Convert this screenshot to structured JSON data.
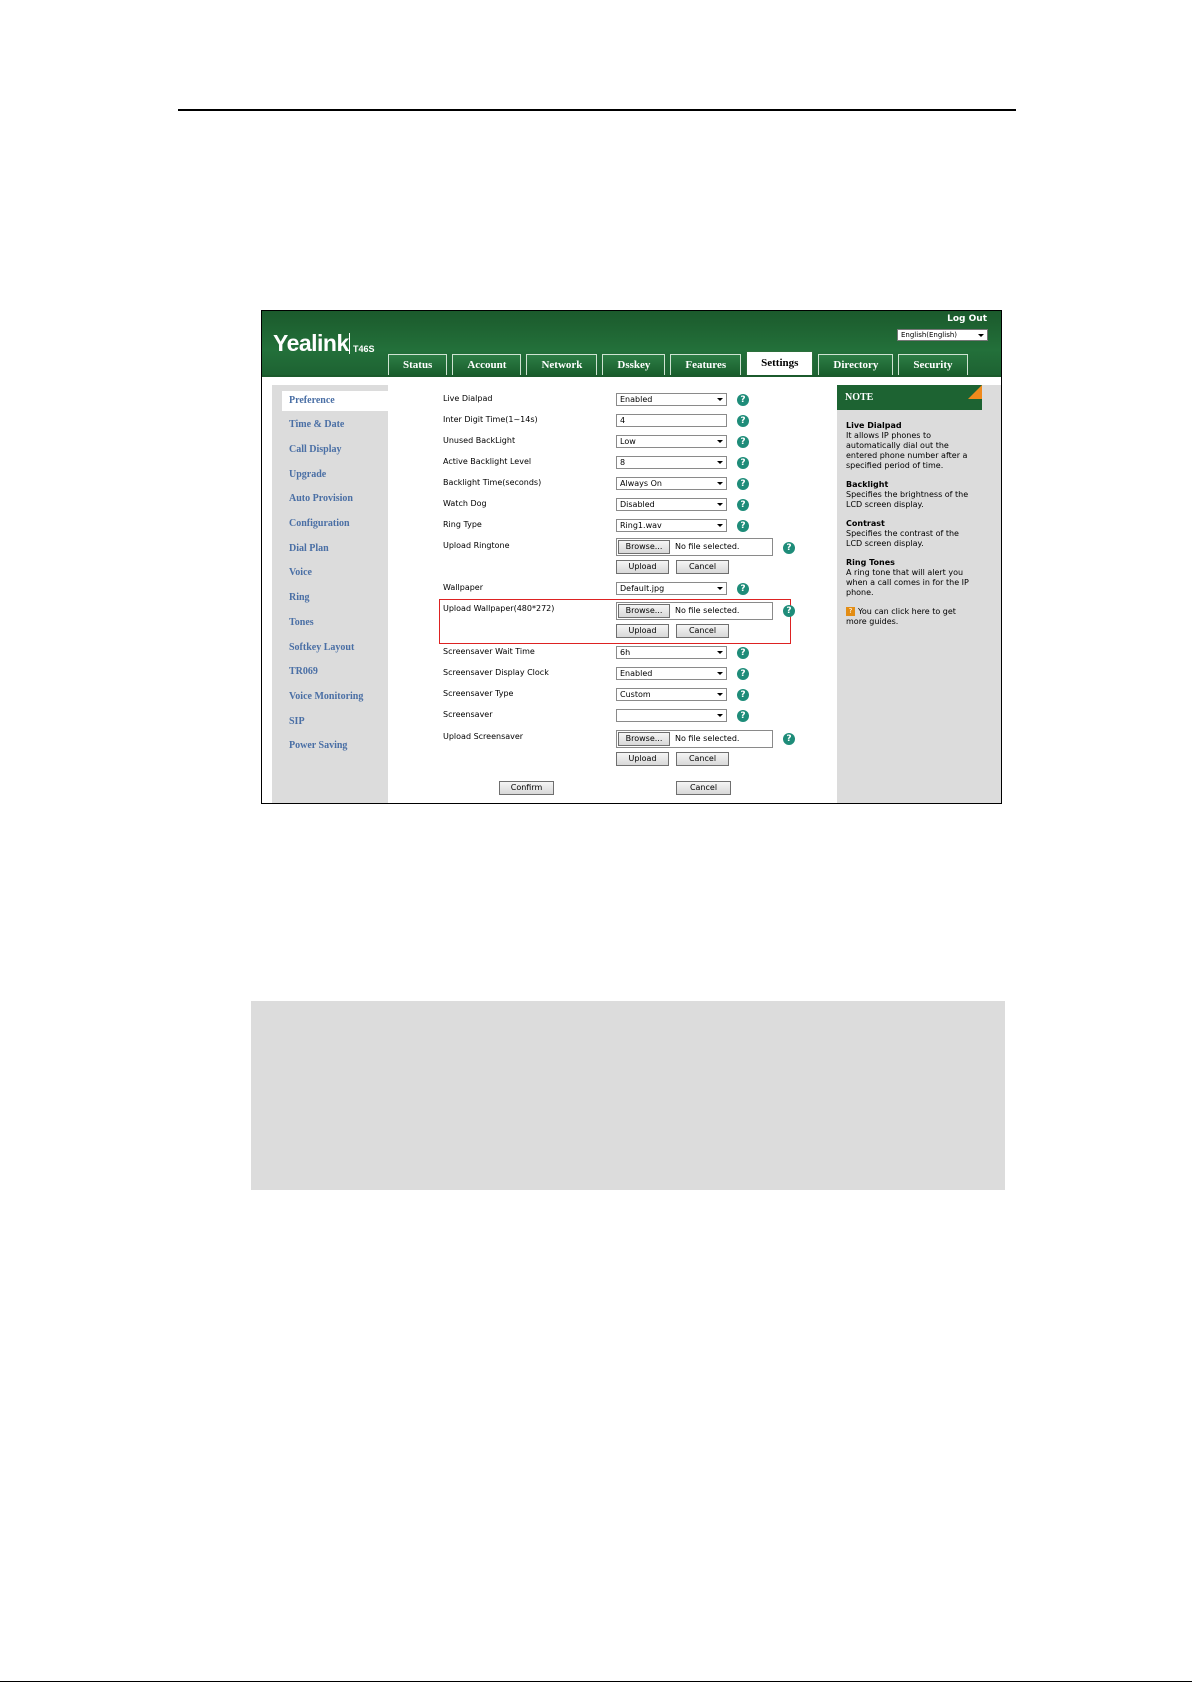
{
  "window": {
    "logo": "Yealink",
    "model": "T46S",
    "logout": "Log Out",
    "language": "English(English)"
  },
  "tabs": [
    "Status",
    "Account",
    "Network",
    "Dsskey",
    "Features",
    "Settings",
    "Directory",
    "Security"
  ],
  "active_tab": "Settings",
  "sidebar": {
    "items": [
      "Preference",
      "Time & Date",
      "Call Display",
      "Upgrade",
      "Auto Provision",
      "Configuration",
      "Dial Plan",
      "Voice",
      "Ring",
      "Tones",
      "Softkey Layout",
      "TR069",
      "Voice Monitoring",
      "SIP",
      "Power Saving"
    ],
    "active": "Preference"
  },
  "form": {
    "live_dialpad": {
      "label": "Live Dialpad",
      "value": "Enabled"
    },
    "inter_digit_time": {
      "label": "Inter Digit Time(1~14s)",
      "value": "4"
    },
    "unused_backlight": {
      "label": "Unused BackLight",
      "value": "Low"
    },
    "active_backlight": {
      "label": "Active Backlight Level",
      "value": "8"
    },
    "backlight_time": {
      "label": "Backlight Time(seconds)",
      "value": "Always On"
    },
    "watch_dog": {
      "label": "Watch Dog",
      "value": "Disabled"
    },
    "ring_type": {
      "label": "Ring Type",
      "value": "Ring1.wav"
    },
    "upload_ringtone": {
      "label": "Upload Ringtone",
      "browse": "Browse...",
      "file": "No file selected.",
      "upload": "Upload",
      "cancel": "Cancel"
    },
    "wallpaper": {
      "label": "Wallpaper",
      "value": "Default.jpg"
    },
    "upload_wallpaper": {
      "label": "Upload Wallpaper(480*272)",
      "browse": "Browse...",
      "file": "No file selected.",
      "upload": "Upload",
      "cancel": "Cancel"
    },
    "screensaver_wait": {
      "label": "Screensaver Wait Time",
      "value": "6h"
    },
    "screensaver_clock": {
      "label": "Screensaver Display Clock",
      "value": "Enabled"
    },
    "screensaver_type": {
      "label": "Screensaver Type",
      "value": "Custom"
    },
    "screensaver": {
      "label": "Screensaver",
      "value": ""
    },
    "upload_screensaver": {
      "label": "Upload Screensaver",
      "browse": "Browse...",
      "file": "No file selected.",
      "upload": "Upload",
      "cancel": "Cancel"
    },
    "confirm": "Confirm",
    "cancel": "Cancel",
    "help_glyph": "?"
  },
  "note": {
    "title": "NOTE",
    "sections": [
      {
        "heading": "Live Dialpad",
        "text": "It allows IP phones to automatically dial out the entered phone number after a specified period of time."
      },
      {
        "heading": "Backlight",
        "text": "Specifies the brightness of the LCD screen display."
      },
      {
        "heading": "Contrast",
        "text": "Specifies the contrast of the LCD screen display."
      },
      {
        "heading": "Ring Tones",
        "text": "A ring tone that will alert you when a call comes in for the IP phone."
      }
    ],
    "tip_icon": "?",
    "tip": "You can click here to get more guides."
  },
  "colors": {
    "brand_green": "#1d6332",
    "sidebar_text": "#4a6fa5",
    "help_icon": "#1e8c79",
    "highlight": "#dd2222",
    "note_corner": "#f08a1c",
    "note_box": "#dcdcdc"
  }
}
